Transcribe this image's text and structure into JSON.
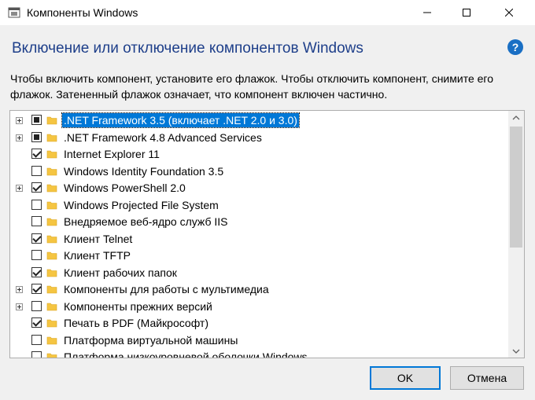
{
  "window": {
    "title": "Компоненты Windows"
  },
  "heading": "Включение или отключение компонентов Windows",
  "help_glyph": "?",
  "description": "Чтобы включить компонент, установите его флажок. Чтобы отключить компонент, снимите его флажок. Затененный флажок означает, что компонент включен частично.",
  "features": [
    {
      "label": ".NET Framework 3.5 (включает .NET 2.0 и 3.0)",
      "state": "partial",
      "expandable": true,
      "selected": true
    },
    {
      "label": ".NET Framework 4.8 Advanced Services",
      "state": "partial",
      "expandable": true,
      "selected": false
    },
    {
      "label": "Internet Explorer 11",
      "state": "checked",
      "expandable": false,
      "selected": false
    },
    {
      "label": "Windows Identity Foundation 3.5",
      "state": "unchecked",
      "expandable": false,
      "selected": false
    },
    {
      "label": "Windows PowerShell 2.0",
      "state": "checked",
      "expandable": true,
      "selected": false
    },
    {
      "label": "Windows Projected File System",
      "state": "unchecked",
      "expandable": false,
      "selected": false
    },
    {
      "label": "Внедряемое веб-ядро служб IIS",
      "state": "unchecked",
      "expandable": false,
      "selected": false
    },
    {
      "label": "Клиент Telnet",
      "state": "checked",
      "expandable": false,
      "selected": false
    },
    {
      "label": "Клиент TFTP",
      "state": "unchecked",
      "expandable": false,
      "selected": false
    },
    {
      "label": "Клиент рабочих папок",
      "state": "checked",
      "expandable": false,
      "selected": false
    },
    {
      "label": "Компоненты для работы с мультимедиа",
      "state": "checked",
      "expandable": true,
      "selected": false
    },
    {
      "label": "Компоненты прежних версий",
      "state": "unchecked",
      "expandable": true,
      "selected": false
    },
    {
      "label": "Печать в PDF (Майкрософт)",
      "state": "checked",
      "expandable": false,
      "selected": false
    },
    {
      "label": "Платформа виртуальной машины",
      "state": "unchecked",
      "expandable": false,
      "selected": false
    },
    {
      "label": "Платформа низкоуровневой оболочки Windows",
      "state": "unchecked",
      "expandable": false,
      "selected": false
    }
  ],
  "buttons": {
    "ok": "OK",
    "cancel": "Отмена"
  },
  "colors": {
    "heading": "#1e3f8a",
    "selection": "#0078d7",
    "folder": "#f5c542",
    "help": "#1a6fc4"
  }
}
